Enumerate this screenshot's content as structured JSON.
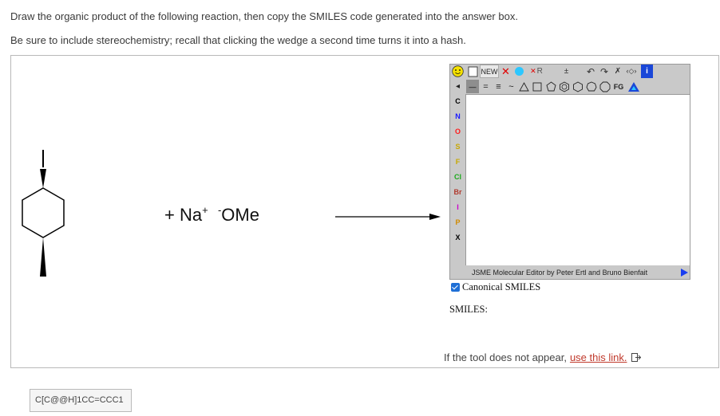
{
  "instructions": {
    "line1": "Draw the organic product of the following reaction, then copy the SMILES code generated into the answer box.",
    "line2": "Be sure to include stereochemistry; recall that clicking the wedge a second time turns it into a hash."
  },
  "reaction": {
    "plus": "+",
    "cation": "Na",
    "cation_charge": "+",
    "anion_charge": "-",
    "anion": "OMe"
  },
  "jsme": {
    "toolbar": {
      "new_label": "NEW",
      "r_label": "R",
      "fg_label": "FG"
    },
    "atoms": [
      "C",
      "N",
      "O",
      "S",
      "F",
      "Cl",
      "Br",
      "I",
      "P",
      "X"
    ],
    "atom_colors": {
      "C": "#000000",
      "N": "#1a1aff",
      "O": "#ff1a1a",
      "S": "#c8a800",
      "F": "#c8a800",
      "Cl": "#1aaa1a",
      "Br": "#b03a2e",
      "I": "#cc00cc",
      "P": "#d08a00",
      "X": "#000000"
    },
    "credit": "JSME Molecular Editor by Peter Ertl and Bruno Bienfait"
  },
  "canonical_smiles": {
    "label": "Canonical SMILES",
    "checked": true
  },
  "smiles_label": "SMILES:",
  "fallback": {
    "text": "If the tool does not appear,",
    "link": "use this link."
  },
  "answer_value": "C[C@@H]1CC=CCC1"
}
